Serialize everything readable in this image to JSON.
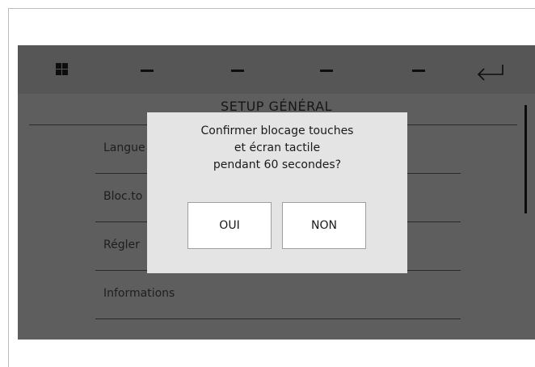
{
  "header": {
    "menu_icon": "grid-menu-icon",
    "tabs": [
      "–",
      "–",
      "–",
      "–"
    ],
    "return_icon": "return-arrow-icon"
  },
  "title": "SETUP GÉNÉRAL",
  "menu": {
    "items": [
      {
        "label": "Langue"
      },
      {
        "label": "Bloc.to"
      },
      {
        "label": "Régler"
      },
      {
        "label": "Informations"
      }
    ]
  },
  "dialog": {
    "line1": "Confirmer blocage touches",
    "line2": "et écran tactile",
    "line3": "pendant 60 secondes?",
    "yes_label": "OUI",
    "no_label": "NON"
  },
  "colors": {
    "screen_bg": "#5e5e5e",
    "dialog_bg": "#e4e4e4",
    "button_bg": "#ffffff"
  }
}
